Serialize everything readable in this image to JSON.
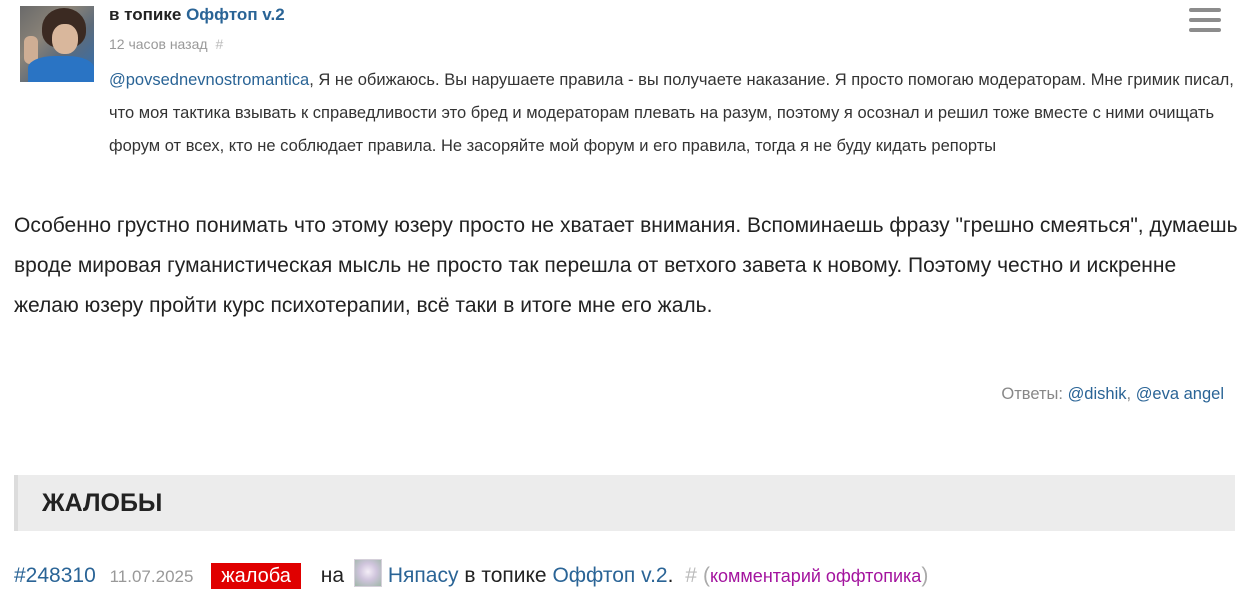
{
  "quote": {
    "in_topic_label": "в топике",
    "topic_link": "Оффтоп v.2",
    "time": "12 часов назад",
    "hash": "#",
    "mention": "@povsednevnostromantica",
    "text": ", Я не обижаюсь. Вы нарушаете правила - вы получаете наказание. Я просто помогаю модераторам. Мне гримик писал, что моя тактика взывать к справедливости это бред и модераторам плевать на разум, поэтому я осознал и решил тоже вместе с ними очищать форум от всех, кто не соблюдает правила. Не засоряйте мой форум и его правила, тогда я не буду кидать репорты"
  },
  "post": {
    "text": "Особенно грустно понимать что этому юзеру просто не хватает внимания. Вспоминаешь фразу \"грешно смеяться\", думаешь вроде мировая гуманистическая мысль не просто так перешла от ветхого завета к новому. Поэтому честно и искренне желаю юзеру пройти курс психотерапии, всё таки в итоге мне его жаль."
  },
  "replies": {
    "label": "Ответы:",
    "users": [
      "@dishik",
      "@eva angel"
    ],
    "separator": ","
  },
  "section": {
    "title": "ЖАЛОБЫ"
  },
  "complaint": {
    "id": "#248310",
    "date": "11.07.2025",
    "badge": "жалоба",
    "on_label": "на",
    "user": "Няпасу",
    "in_topic_label": "в топике",
    "topic": "Оффтоп v.2",
    "dot": ".",
    "hash": "#",
    "paren_open": "(",
    "note": "комментарий оффтопика",
    "paren_close": ")"
  },
  "colors": {
    "link": "#2a6496",
    "badge_bg": "#e00000",
    "note": "#a3139e",
    "section_bg": "#ececec"
  },
  "icons": {
    "menu": "hamburger-menu-icon",
    "quote_avatar": "user-avatar",
    "complaint_avatar": "user-avatar-small"
  }
}
